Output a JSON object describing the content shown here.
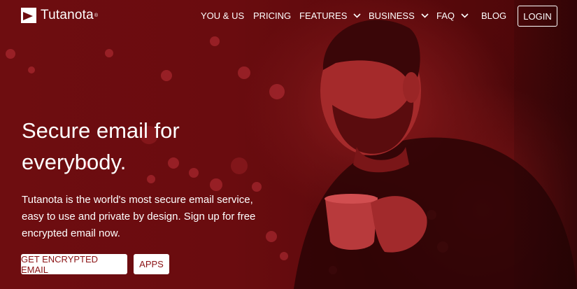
{
  "brand": {
    "name": "Tutanota",
    "registered_mark": "®",
    "logo_icon": "tutanota-logo-icon"
  },
  "nav": {
    "items": [
      {
        "label": "YOU & US",
        "has_dropdown": false
      },
      {
        "label": "PRICING",
        "has_dropdown": false
      },
      {
        "label": "FEATURES",
        "has_dropdown": true
      },
      {
        "label": "BUSINESS",
        "has_dropdown": true
      },
      {
        "label": "FAQ",
        "has_dropdown": true
      },
      {
        "label": "BLOG",
        "has_dropdown": false
      }
    ],
    "login_label": "LOGIN",
    "dropdown_icon": "chevron-down-icon"
  },
  "hero": {
    "headline": "Secure email for everybody.",
    "description": "Tutanota is the world's most secure email service, easy to use and private by design. Sign up for free encrypted email now.",
    "primary_cta": "GET ENCRYPTED EMAIL",
    "secondary_cta": "APPS"
  },
  "colors": {
    "overlay": "#6e0d10",
    "button_text": "#8b1214",
    "text": "#ffffff"
  }
}
